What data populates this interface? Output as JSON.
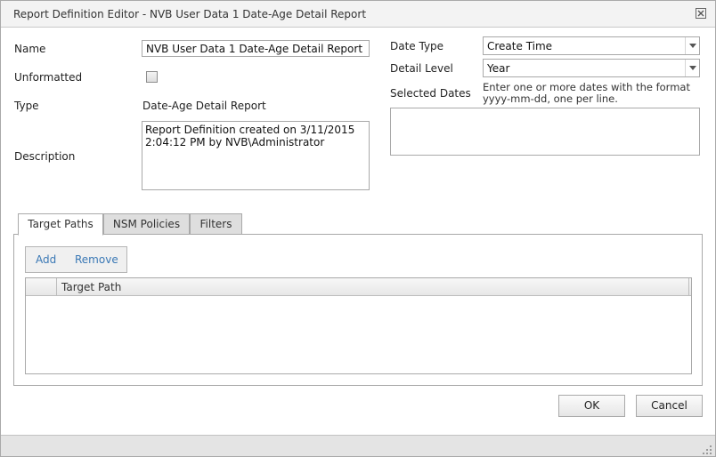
{
  "window": {
    "title": "Report Definition Editor - NVB User Data 1 Date-Age Detail Report"
  },
  "form": {
    "name_label": "Name",
    "name_value": "NVB User Data 1 Date-Age Detail Report",
    "unformatted_label": "Unformatted",
    "unformatted_checked": false,
    "type_label": "Type",
    "type_value": "Date-Age Detail Report",
    "description_label": "Description",
    "description_value": "Report Definition created on 3/11/2015 2:04:12 PM by NVB\\Administrator",
    "date_type_label": "Date Type",
    "date_type_value": "Create Time",
    "detail_level_label": "Detail Level",
    "detail_level_value": "Year",
    "selected_dates_label": "Selected Dates",
    "selected_dates_hint": "Enter one or more dates with the format yyyy-mm-dd, one per line.",
    "selected_dates_value": ""
  },
  "tabs": [
    {
      "label": "Target Paths",
      "active": true
    },
    {
      "label": "NSM Policies",
      "active": false
    },
    {
      "label": "Filters",
      "active": false
    }
  ],
  "target_paths": {
    "toolbar": {
      "add_label": "Add",
      "remove_label": "Remove"
    },
    "columns": [
      "Target Path"
    ],
    "rows": []
  },
  "buttons": {
    "ok_label": "OK",
    "cancel_label": "Cancel"
  },
  "icons": {
    "close": "close-icon",
    "dropdown": "chevron-down-icon",
    "resize": "resize-grip-icon"
  },
  "colors": {
    "link_blue": "#3a78b5",
    "border": "#a9a9a9",
    "titlebar": "#f3f3f3",
    "statusbar": "#e4e4e4"
  }
}
